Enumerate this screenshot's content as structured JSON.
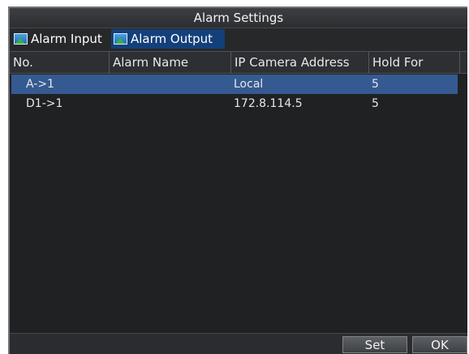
{
  "window": {
    "title": "Alarm Settings"
  },
  "tabs": [
    {
      "label": "Alarm Input",
      "icon": "image-icon"
    },
    {
      "label": "Alarm Output",
      "icon": "image-icon",
      "active": true
    }
  ],
  "table": {
    "headers": [
      "No.",
      "Alarm Name",
      "IP Camera Address",
      "Hold For"
    ],
    "rows": [
      {
        "no": "A->1",
        "name": "",
        "ip": "Local",
        "hold": "5",
        "selected": true
      },
      {
        "no": "D1->1",
        "name": "",
        "ip": "172.8.114.5",
        "hold": "5",
        "selected": false
      }
    ]
  },
  "buttons": {
    "set": "Set",
    "ok": "OK"
  },
  "colors": {
    "selection": "#355a92",
    "active_tab": "#13407a",
    "background": "#26282a"
  }
}
